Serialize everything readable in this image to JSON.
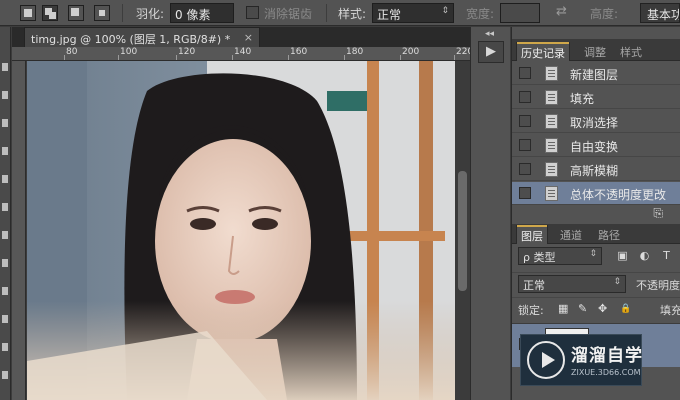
{
  "options_bar": {
    "feather_label": "羽化:",
    "feather_value": "0 像素",
    "antialias_label": "消除锯齿",
    "style_label": "样式:",
    "style_value": "正常",
    "width_label": "宽度:",
    "height_label": "高度:",
    "adjust_edge_button": "基本功"
  },
  "document": {
    "tab_title": "timg.jpg @ 100% (图层 1, RGB/8#) *",
    "close_glyph": "×",
    "ruler_ticks": [
      "80",
      "100",
      "120",
      "140",
      "160",
      "180",
      "200",
      "220",
      "240"
    ]
  },
  "collapsed_strip": {
    "collapse_glyph": "◂◂",
    "play_glyph": "▶"
  },
  "history_panel": {
    "tabs": [
      "历史记录",
      "调整",
      "样式"
    ],
    "items": [
      {
        "label": "新建图层"
      },
      {
        "label": "填充"
      },
      {
        "label": "取消选择"
      },
      {
        "label": "自由变换"
      },
      {
        "label": "高斯模糊"
      },
      {
        "label": "总体不透明度更改",
        "selected": true
      }
    ],
    "footer_glyph": "⎘"
  },
  "layers_panel": {
    "tabs": [
      "图层",
      "通道",
      "路径"
    ],
    "filter_label": "类型",
    "filter_search_glyph": "ρ",
    "blend_mode": "正常",
    "opacity_label": "不透明度",
    "lock_label": "锁定:",
    "fill_label": "填充",
    "filter_icons": [
      "image-filter-icon",
      "adjustment-filter-icon",
      "type-filter-icon"
    ],
    "filter_glyphs": [
      "▣",
      "◐",
      "T"
    ],
    "lock_glyphs": [
      "▦",
      "✎",
      "✥",
      "🔒"
    ]
  },
  "watermark": {
    "name": "溜溜自学",
    "url": "ZIXUE.3D66.COM"
  },
  "colors": {
    "selection_blue": "#6f7f99",
    "tab_accent": "#cfa74a",
    "panel_bg": "#535353"
  }
}
